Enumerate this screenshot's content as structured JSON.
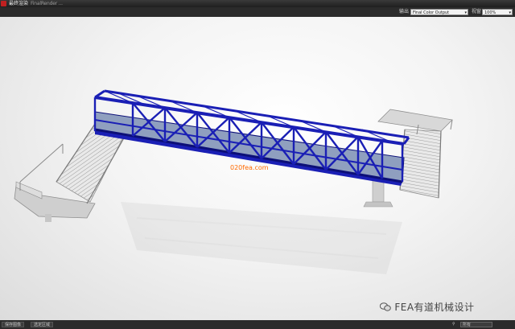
{
  "window": {
    "title": "最终渲染",
    "tabs_text": "FinalRender ..."
  },
  "toolbar": {
    "output_label": "输出",
    "output_value": "Final Color Output",
    "zoom_label": "视窗",
    "zoom_value": "100%"
  },
  "scene": {
    "watermark_overlay": "020fea.com"
  },
  "watermark": {
    "text": "FEA有道机械设计"
  },
  "statusbar": {
    "button1": "保存图像",
    "button2": "选定区域",
    "zoom_value": "所有"
  },
  "colors": {
    "truss": "#1a1fb5",
    "truss_dark": "#0c0f78",
    "stairs": "#e6e6e6",
    "background": "#f4f4f4"
  }
}
